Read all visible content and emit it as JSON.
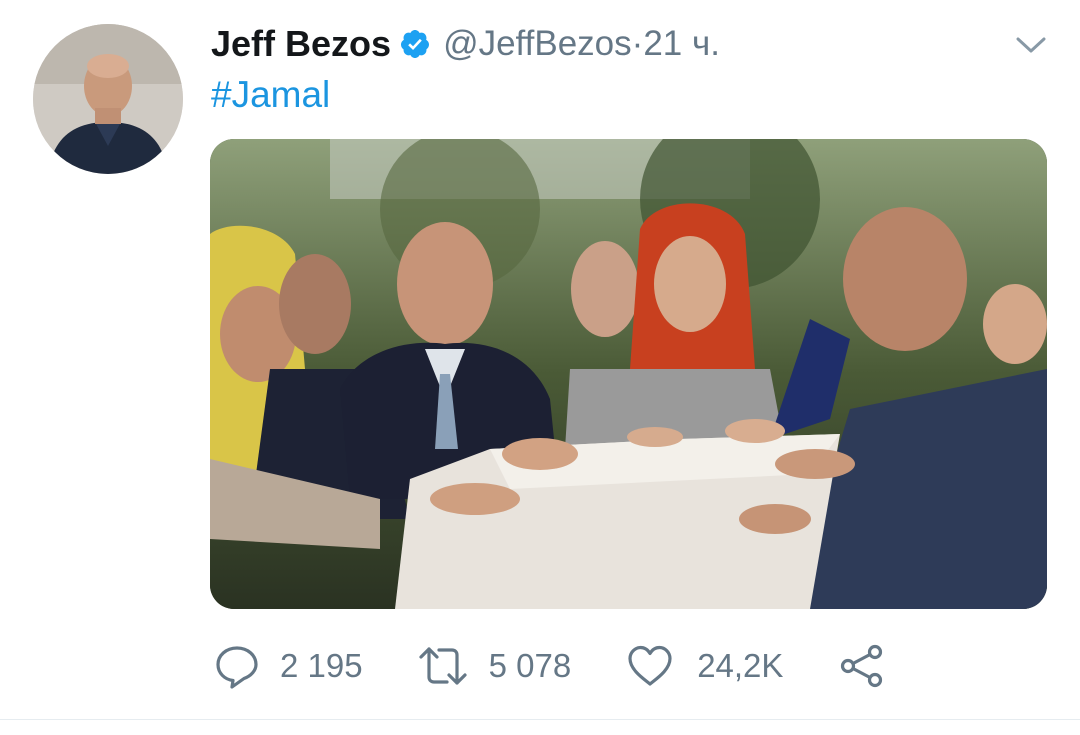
{
  "tweet": {
    "author_name": "Jeff Bezos",
    "handle": "@JeffBezos",
    "separator": " · ",
    "time": "21 ч.",
    "text": "#Jamal"
  },
  "actions": {
    "replies": "2 195",
    "retweets": "5 078",
    "likes": "24,2K"
  },
  "icons": {
    "verified": "verified-badge-icon",
    "menu": "chevron-down-icon",
    "reply": "reply-icon",
    "retweet": "retweet-icon",
    "like": "heart-icon",
    "share": "share-icon"
  },
  "colors": {
    "link": "#1b95e0",
    "secondary_text": "#657786",
    "verified": "#1da1f2"
  }
}
